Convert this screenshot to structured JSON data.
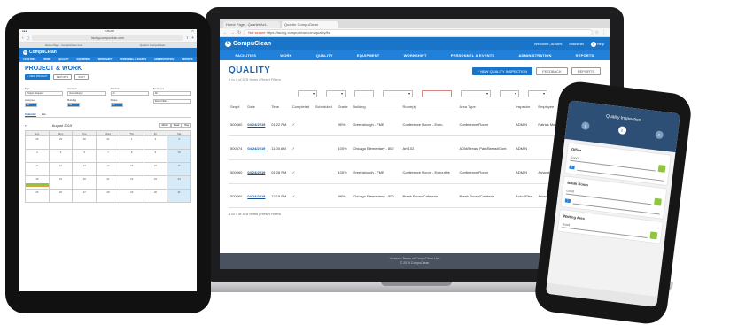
{
  "laptop": {
    "browser": {
      "tabs": [
        "Home Page - Quarter Act...",
        "Quarter CompuClean"
      ],
      "url_security": "Not secure",
      "url": "https://facing.compuclean.com/quality/list"
    },
    "app": {
      "logo": "CompuClean",
      "welcome": "Welcome, ADMIN",
      "region": "Industrial",
      "help": "Help",
      "nav": [
        "FACILITIES",
        "WORK",
        "QUALITY",
        "EQUIPMENT",
        "WORKSHIFT",
        "PERSONNEL & EVENTS",
        "ADMINISTRATION",
        "REPORTS"
      ]
    },
    "page": {
      "title": "QUALITY",
      "subtitle": "1 to 4 of 578 Items  |  Reset Filters",
      "new_button": "+ NEW QUALITY INSPECTION",
      "buttons": [
        "FEEDBACK",
        "REPORTS"
      ],
      "columns": [
        "Seq #",
        "Date",
        "Time",
        "Completed",
        "Scheduled",
        "Grade",
        "Building",
        "Room(s)",
        "Area Type",
        "Inspector",
        "Employee",
        "Corrective Action"
      ],
      "rows": [
        [
          "500660",
          "04/24/2019",
          "01:22 PM",
          "✓",
          "",
          "95%",
          "Greensburgh - FME",
          "Conference Room - Exec.",
          "Conference Room",
          "ADMIN",
          "Patrick Murphy",
          ""
        ],
        [
          "500474",
          "04/24/2019",
          "11:00 AM",
          "✓",
          "",
          "100%",
          "Chicago Elementary - 802",
          "Art 102",
          "ADM/Breast Pain/Breast/Cont",
          "ADMIN",
          "",
          ""
        ],
        [
          "500660",
          "04/24/2019",
          "01:28 PM",
          "✓",
          "",
          "100%",
          "Greensburgh - FME",
          "Conference Room - Executive",
          "Conference Room",
          "ADMIN",
          "Amanda Mac",
          ""
        ],
        [
          "500660",
          "04/24/2019",
          "12:18 PM",
          "✓",
          "",
          "88%",
          "Chicago Elementary - 802",
          "Break Room/Cafeteria",
          "Break Room/Cafeteria",
          "ActualFlex",
          "Amanda Mac",
          ""
        ]
      ],
      "pager_left": "1 to 4 of 578 Items  |  Reset Filters",
      "pager_prev": "« Previous",
      "pager_pages": [
        "1",
        "2",
        "3",
        "4",
        "5",
        "»"
      ],
      "footer_line1": "Version   •   Terms of CompuClean Use",
      "footer_line2": "© 2019 CompuClean"
    }
  },
  "tablet": {
    "status_time": "9:45 AM",
    "url": "facing.compuclean.com",
    "tabs": [
      "Home Page - CompuClean.com",
      "Quarter CompuClean"
    ],
    "logo": "CompuClean",
    "nav": [
      "FACILITIES",
      "WORK",
      "QUALITY",
      "EQUIPMENT",
      "WORKSHIFT",
      "PERSONNEL & EVENTS",
      "ADMINISTRATION",
      "REPORTS"
    ],
    "title": "PROJECT & WORK",
    "buttons": [
      "+ NEW PROJECT",
      "REPORTS",
      "SORT"
    ],
    "fields": [
      {
        "label": "Type",
        "value": "Project Request"
      },
      {
        "label": "Account",
        "value": "Greensburgh"
      },
      {
        "label": "Assistant",
        "value": "All"
      },
      {
        "label": "Employee",
        "value": "All"
      },
      {
        "label": "Assigned",
        "value": "All"
      },
      {
        "label": "Building",
        "value": "All"
      },
      {
        "label": "Status",
        "value": "All"
      },
      {
        "label": "",
        "value": "Reset Filters"
      }
    ],
    "view_tabs": [
      "Calendar",
      "List"
    ],
    "calendar": {
      "title": "August 2019",
      "views": [
        "Month",
        "Week",
        "Day"
      ],
      "days": [
        "Sun",
        "Mon",
        "Tue",
        "Wed",
        "Thu",
        "Fri",
        "Sat"
      ],
      "dates": [
        "28",
        "29",
        "30",
        "31",
        "1",
        "2",
        "3",
        "4",
        "5",
        "6",
        "7",
        "8",
        "9",
        "10",
        "11",
        "12",
        "13",
        "14",
        "15",
        "16",
        "17",
        "18",
        "19",
        "20",
        "21",
        "22",
        "23",
        "24",
        "25",
        "26",
        "27",
        "28",
        "29",
        "30",
        "31"
      ]
    }
  },
  "phone": {
    "title": "Quality Inspection",
    "steps": [
      "1",
      "2",
      "3"
    ],
    "cards": [
      {
        "title": "Office",
        "row1": "Good",
        "row2": "7"
      },
      {
        "title": "Break Room",
        "row1": "Good",
        "row2": "7"
      },
      {
        "title": "Waiting Area",
        "row1": "Good",
        "row2": "7"
      }
    ]
  },
  "colors": {
    "brand_blue": "#1a75c9",
    "nav_blue": "#2180da",
    "title_blue": "#1a65b8",
    "footer_gray": "#4a5260",
    "phone_header": "#2d4f75",
    "ok_green": "#8ec63f"
  }
}
